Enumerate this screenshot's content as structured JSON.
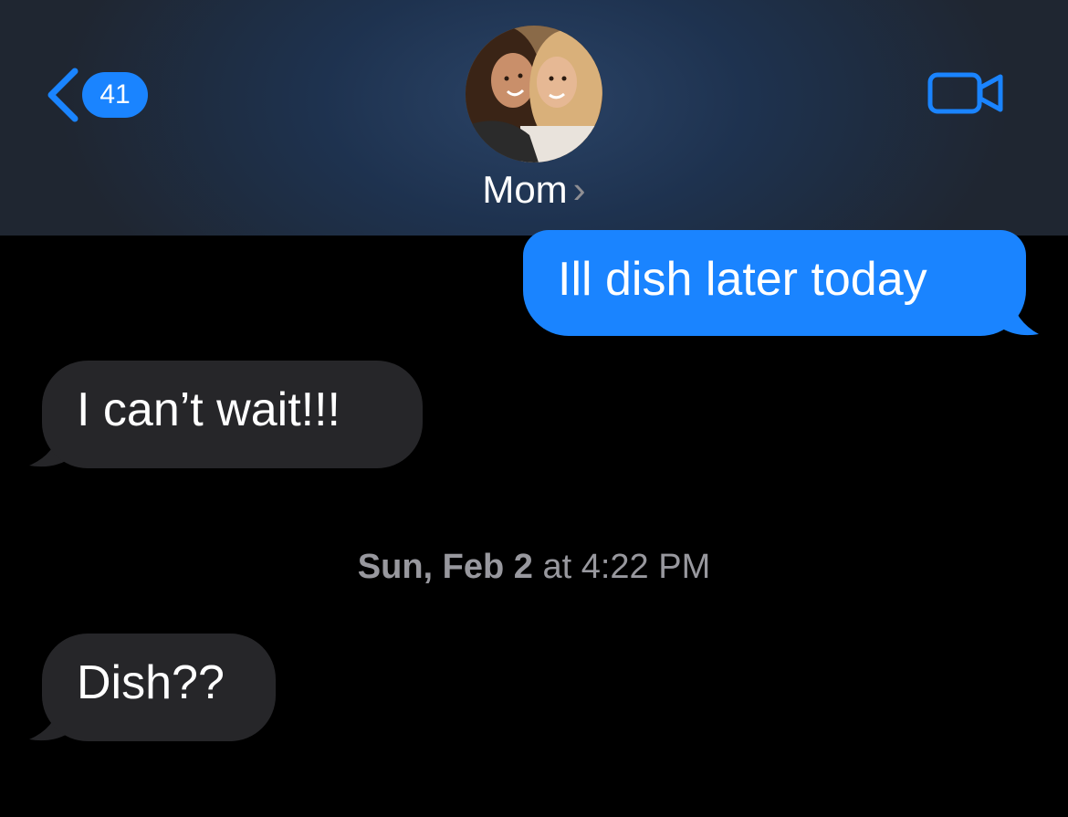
{
  "header": {
    "back_count": "41",
    "contact_name": "Mom",
    "contact_chevron": "›",
    "back_icon": "chevron-left-icon",
    "video_icon": "video-camera-icon"
  },
  "messages": [
    {
      "direction": "outgoing",
      "text": "Ill dish later today"
    },
    {
      "direction": "incoming",
      "text": "I can’t wait!!!"
    },
    {
      "direction": "incoming",
      "text": "Dish??"
    }
  ],
  "timestamp": {
    "day_date": "Sun, Feb 2",
    "time": "at 4:22 PM"
  },
  "colors": {
    "accent": "#1a84ff",
    "incoming_bubble": "#262629",
    "background": "#000000"
  }
}
